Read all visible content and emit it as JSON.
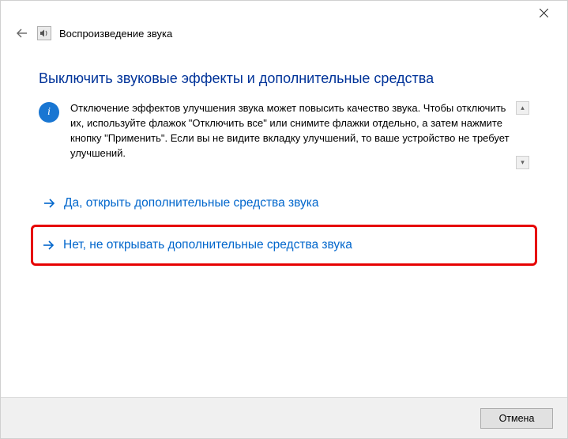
{
  "header": {
    "title": "Воспроизведение звука"
  },
  "main": {
    "heading": "Выключить звуковые эффекты и дополнительные средства",
    "info_text": "Отключение эффектов улучшения звука может повысить качество звука. Чтобы отключить их, используйте флажок \"Отключить все\" или снимите флажки отдельно, а затем нажмите кнопку \"Применить\". Если вы не видите вкладку улучшений, то ваше устройство не требует улучшений.",
    "option_yes": "Да, открыть дополнительные средства звука",
    "option_no": "Нет, не открывать дополнительные средства звука"
  },
  "footer": {
    "cancel": "Отмена"
  },
  "icons": {
    "info_glyph": "i",
    "scroll_up": "▴",
    "scroll_down": "▾"
  }
}
